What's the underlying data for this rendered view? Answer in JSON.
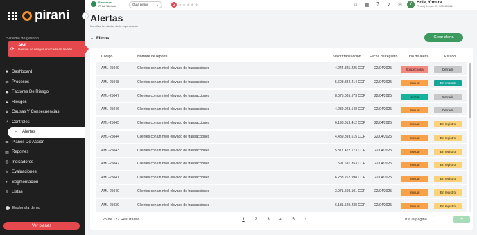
{
  "app": {
    "logo_text": "pirani",
    "system_label": "Sistema de gestión",
    "module": {
      "title": "AML",
      "subtitle": "Gestión de riesgos enfocado en lavado"
    },
    "nav": [
      {
        "label": "Dashboard",
        "icon": "■"
      },
      {
        "label": "Procesos",
        "icon": "⇄"
      },
      {
        "label": "Factores De Riesgo",
        "icon": "◆"
      },
      {
        "label": "Riesgos",
        "icon": "▲"
      },
      {
        "label": "Causas Y Consecuencias",
        "icon": "❖"
      },
      {
        "label": "Controles",
        "icon": "✓"
      },
      {
        "label": "Alertas",
        "icon": "⚠"
      },
      {
        "label": "Planes De Acción",
        "icon": "☰"
      },
      {
        "label": "Reportes",
        "icon": "▤"
      },
      {
        "label": "Indicadores",
        "icon": "◎"
      },
      {
        "label": "Evaluaciones",
        "icon": "✎"
      },
      {
        "label": "Segmentación",
        "icon": "◐"
      },
      {
        "label": "Listas",
        "icon": "≡"
      }
    ],
    "explore_demo": "Explora la demo",
    "ver_planes": "Ver planes"
  },
  "topbar": {
    "company_name": "Empresas",
    "company_sub": "ITHAL / Ilimitado",
    "guide": "Guía pirani",
    "rating_badge": "G",
    "stars": "★★★★★",
    "greeting": "Hola, Yomira",
    "user_sub": "Pirani | Demo - ID: 3000000419",
    "avatar": "Y"
  },
  "page": {
    "title": "Alertas",
    "subtitle": "Identifica las alertas de tu organización",
    "filters_label": "Filtros",
    "create_button": "Crear alerta"
  },
  "table": {
    "headers": {
      "codigo": "Código",
      "nombre": "Nombre de reporte",
      "valor": "Valor transacción",
      "fecha": "Fecha de registro",
      "tipo": "Tipo de alerta",
      "estado": "Estado"
    },
    "rows": [
      {
        "code": "AML-25049",
        "name": "Clientes con un nivel elevado de transacciones",
        "value": "4.244.825.225 COP",
        "date": "22/04/2025",
        "type": "Sospechosa",
        "type_class": "sospechosa",
        "status": "Cerrado",
        "status_class": "cerrado"
      },
      {
        "code": "AML-25048",
        "name": "Clientes con un nivel elevado de transacciones",
        "value": "5.603.884.414 COP",
        "date": "22/04/2025",
        "type": "Inusual",
        "type_class": "inusual",
        "status": "En análisis",
        "status_class": "analisis"
      },
      {
        "code": "AML-25047",
        "name": "Clientes con un nivel elevado de transacciones",
        "value": "8.075.085.573 COP",
        "date": "22/04/2025",
        "type": "Normal",
        "type_class": "normal",
        "status": "Cerrado",
        "status_class": "cerrado"
      },
      {
        "code": "AML-25046",
        "name": "Clientes con un nivel elevado de transacciones",
        "value": "4.289.923.548 COP",
        "date": "22/04/2025",
        "type": "Inusual",
        "type_class": "inusual",
        "status": "Cerrado",
        "status_class": "cerrado"
      },
      {
        "code": "AML-25045",
        "name": "Clientes con un nivel elevado de transacciones",
        "value": "6.193.813.412 COP",
        "date": "22/04/2025",
        "type": "Inusual",
        "type_class": "inusual",
        "status": "En registro",
        "status_class": "registro"
      },
      {
        "code": "AML-25044",
        "name": "Clientes con un nivel elevado de transacciones",
        "value": "4.439.893.615 COP",
        "date": "22/04/2025",
        "type": "Inusual",
        "type_class": "inusual",
        "status": "En registro",
        "status_class": "registro"
      },
      {
        "code": "AML-25043",
        "name": "Clientes con un nivel elevado de transacciones",
        "value": "5.817.422.173 COP",
        "date": "22/04/2025",
        "type": "Inusual",
        "type_class": "inusual",
        "status": "En registro",
        "status_class": "registro"
      },
      {
        "code": "AML-25042",
        "name": "Clientes con un nivel elevado de transacciones",
        "value": "7.591.691.853 COP",
        "date": "22/04/2025",
        "type": "Inusual",
        "type_class": "inusual",
        "status": "En registro",
        "status_class": "registro"
      },
      {
        "code": "AML-25041",
        "name": "Clientes con un nivel elevado de transacciones",
        "value": "6.288.262.998 COP",
        "date": "22/04/2025",
        "type": "Inusual",
        "type_class": "inusual",
        "status": "En registro",
        "status_class": "registro"
      },
      {
        "code": "AML-25040",
        "name": "Clientes con un nivel elevado de transacciones",
        "value": "3.971.508.101 COP",
        "date": "22/04/2025",
        "type": "Inusual",
        "type_class": "inusual",
        "status": "En registro",
        "status_class": "registro"
      },
      {
        "code": "AML-25039",
        "name": "Clientes con un nivel elevado de transacciones",
        "value": "6.131.529.238 COP",
        "date": "22/04/2025",
        "type": "Inusual",
        "type_class": "inusual",
        "status": "En registro",
        "status_class": "registro"
      }
    ]
  },
  "pagination": {
    "results": "1 - 25 de 122 Resultados",
    "pages": [
      "1",
      "2",
      "3",
      "4",
      "5"
    ],
    "next": "›",
    "goto_label": "Ir a la página",
    "goto_button": "➜"
  },
  "colors": {
    "brand_red": "#e5484d",
    "brand_orange": "#f28c28",
    "green": "#3c9a5f"
  }
}
